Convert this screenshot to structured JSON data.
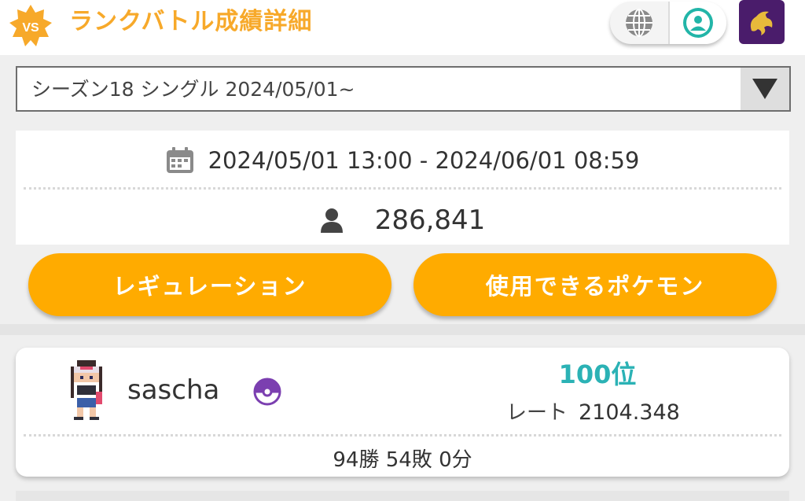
{
  "header": {
    "badge_text": "VS",
    "title": "ランクバトル成績詳細",
    "globe_icon": "globe-icon",
    "user_icon": "user-circle-icon",
    "colors": {
      "title": "#f7a92a",
      "badge": "#f7a92a",
      "user_icon": "#22b5a8"
    }
  },
  "season_select": {
    "selected": "シーズン18 シングル 2024/05/01~",
    "arrow_icon": "triangle-down-icon"
  },
  "info": {
    "period": "2024/05/01 13:00 - 2024/06/01 08:59",
    "players": "286,841",
    "calendar_icon": "calendar-icon",
    "person_icon": "person-icon"
  },
  "buttons": {
    "regulation": "レギュレーション",
    "usable_pokemon": "使用できるポケモン",
    "color": "#ffab00"
  },
  "ranking": {
    "name": "sascha",
    "rank": "100位",
    "rate_label": "レート",
    "rate": "2104.348",
    "record": "94勝 54敗 0分",
    "rank_color": "#2bb2b5",
    "ball_color": "#7b3fb0"
  }
}
